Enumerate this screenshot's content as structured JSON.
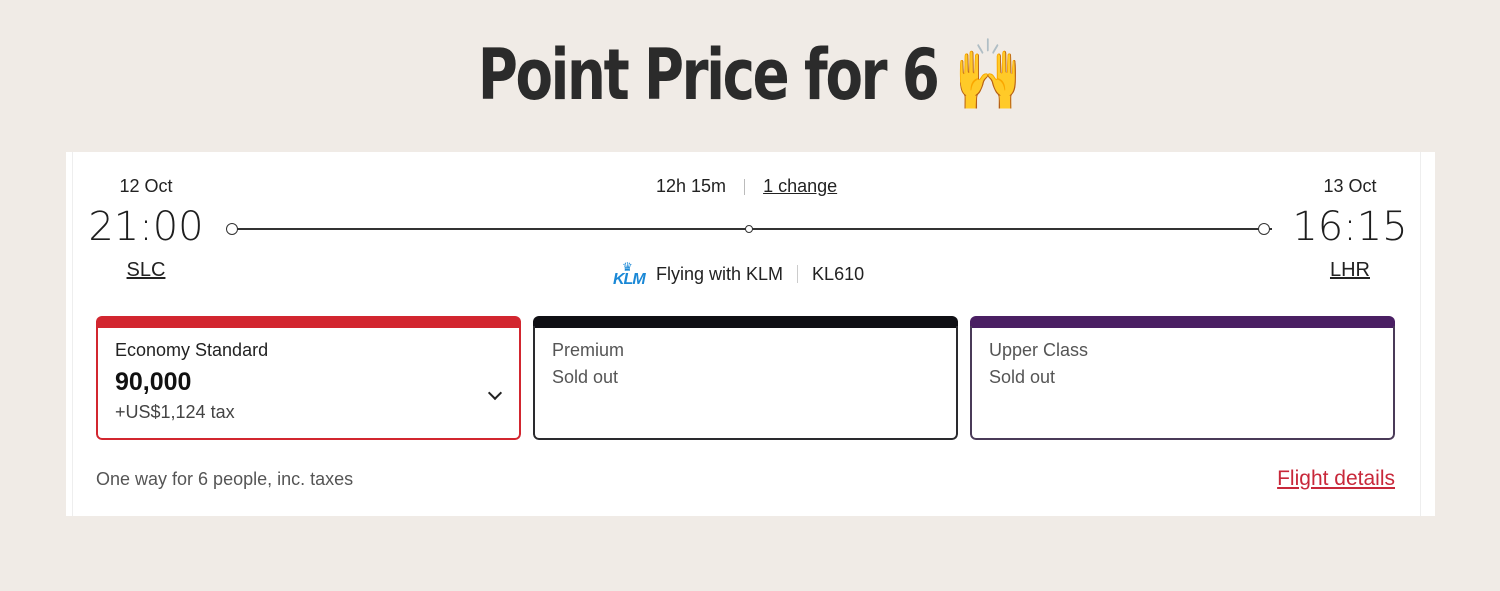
{
  "headline": {
    "text": "Point Price for 6",
    "emoji": "🙌"
  },
  "flight": {
    "departure": {
      "date": "12 Oct",
      "time": "21:00",
      "airport": "SLC"
    },
    "arrival": {
      "date": "13 Oct",
      "time": "16:15",
      "airport": "LHR"
    },
    "duration": "12h 15m",
    "stops_label": "1 change",
    "operator": {
      "logo_text": "KLM",
      "label": "Flying with KLM",
      "flight_number": "KL610"
    }
  },
  "fares": [
    {
      "name": "Economy Standard",
      "price": "90,000",
      "tax": "+US$1,124 tax",
      "color": "#d2262f"
    },
    {
      "name": "Premium",
      "status": "Sold out",
      "color": "#0f0f14"
    },
    {
      "name": "Upper Class",
      "status": "Sold out",
      "color": "#4a1f63"
    }
  ],
  "footer": {
    "note": "One way for 6 people, inc. taxes",
    "details_link": "Flight details"
  }
}
